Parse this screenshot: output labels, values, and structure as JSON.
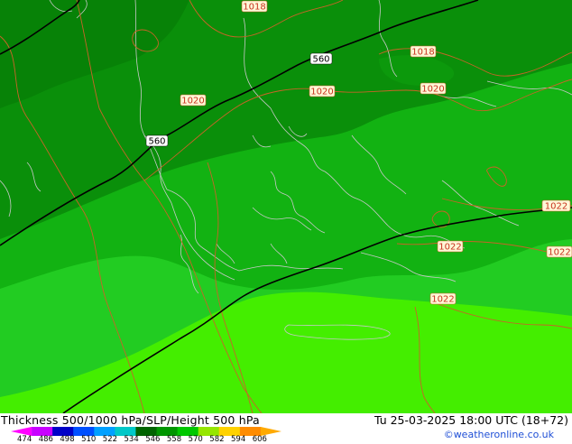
{
  "map": {
    "isobars": [
      "1018",
      "1018",
      "1020",
      "1020",
      "1020",
      "1022",
      "1022",
      "1022",
      "1022"
    ],
    "height_contours": [
      "560",
      "560"
    ],
    "colors": {
      "thickness_dark": "#0a8f0a",
      "thickness_mid": "#12b212",
      "thickness_light": "#22cc22",
      "thickness_bright": "#44ee00",
      "isobar": "#c86428",
      "height_line": "#000000",
      "coastline": "#c8c8c8"
    }
  },
  "footer": {
    "title": "Thickness 500/1000 hPa/SLP/Height 500 hPa",
    "timestamp": "Tu 25-03-2025 18:00 UTC (18+72)",
    "credit": "©weatheronline.co.uk",
    "scale_ticks": [
      "474",
      "486",
      "498",
      "510",
      "522",
      "534",
      "546",
      "558",
      "570",
      "582",
      "594",
      "606"
    ],
    "scale_colors": [
      "#ff00ff",
      "#c800ff",
      "#0000c8",
      "#0050ff",
      "#00a0ff",
      "#00c8c8",
      "#006400",
      "#009600",
      "#00c800",
      "#96e600",
      "#ffd200",
      "#ff8c00",
      "#ffaa00"
    ]
  }
}
